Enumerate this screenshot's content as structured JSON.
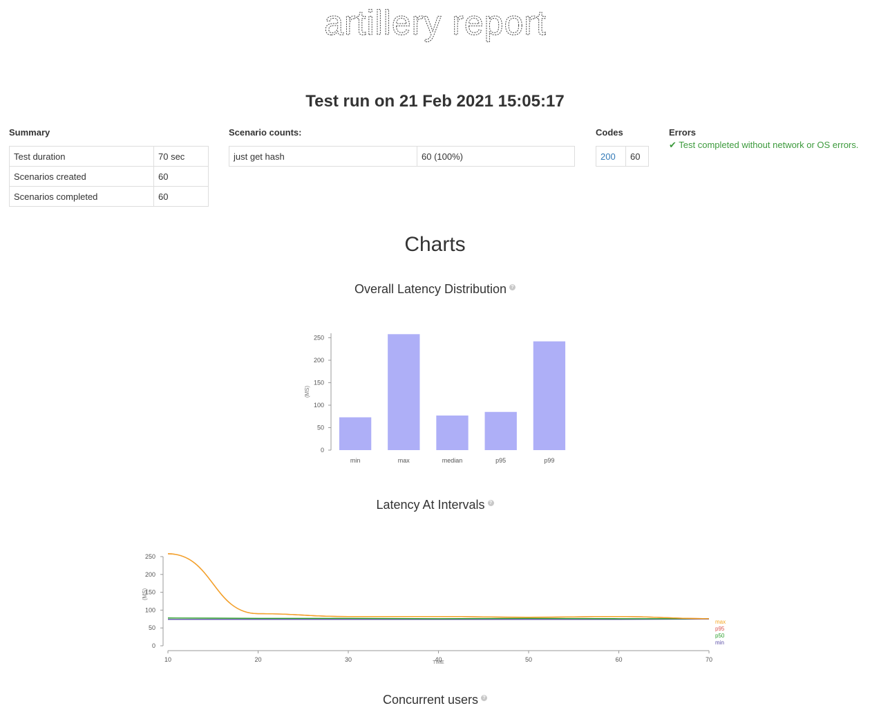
{
  "logo": {
    "text": "artillery report"
  },
  "report": {
    "title": "Test run on 21 Feb 2021 15:05:17"
  },
  "summary": {
    "heading": "Summary",
    "rows": [
      {
        "label": "Test duration",
        "value": "70 sec"
      },
      {
        "label": "Scenarios created",
        "value": "60"
      },
      {
        "label": "Scenarios completed",
        "value": "60"
      }
    ]
  },
  "scenario_counts": {
    "heading": "Scenario counts:",
    "rows": [
      {
        "label": "just get hash",
        "value": "60 (100%)"
      }
    ]
  },
  "codes": {
    "heading": "Codes",
    "code": "200",
    "count": "60"
  },
  "errors": {
    "heading": "Errors",
    "message": "✔ Test completed without network or OS errors."
  },
  "charts": {
    "heading": "Charts",
    "help_glyph": "?",
    "latency_title": "Overall Latency Distribution",
    "intervals_title": "Latency At Intervals",
    "concurrent_title": "Concurrent users"
  },
  "chart_data": [
    {
      "type": "bar",
      "title": "Overall Latency Distribution",
      "ylabel": "(MS)",
      "categories": [
        "min",
        "max",
        "median",
        "p95",
        "p99"
      ],
      "values": [
        73,
        258,
        77,
        85,
        242
      ],
      "ylim": [
        0,
        260
      ],
      "yticks": [
        0,
        50,
        100,
        150,
        200,
        250
      ],
      "color": "#aeaff7"
    },
    {
      "type": "line",
      "title": "Latency At Intervals",
      "xlabel": "TIME",
      "ylabel": "(MS)",
      "x": [
        10,
        20,
        30,
        40,
        50,
        60,
        70
      ],
      "xticks": [
        10,
        20,
        30,
        40,
        50,
        60,
        70
      ],
      "yticks": [
        0,
        50,
        100,
        150,
        200,
        250
      ],
      "ylim": [
        0,
        250
      ],
      "xlim": [
        10,
        70
      ],
      "series": [
        {
          "name": "max",
          "color": "#f5a623",
          "values": [
            258,
            90,
            82,
            82,
            80,
            82,
            76
          ]
        },
        {
          "name": "p95",
          "color": "#d9534f",
          "values": [
            258,
            90,
            82,
            82,
            80,
            82,
            76
          ]
        },
        {
          "name": "p50",
          "color": "#2ca02c",
          "values": [
            78,
            77,
            77,
            76,
            77,
            76,
            76
          ]
        },
        {
          "name": "min",
          "color": "#5b4ea8",
          "values": [
            74,
            74,
            74,
            74,
            74,
            74,
            75
          ]
        }
      ]
    }
  ]
}
